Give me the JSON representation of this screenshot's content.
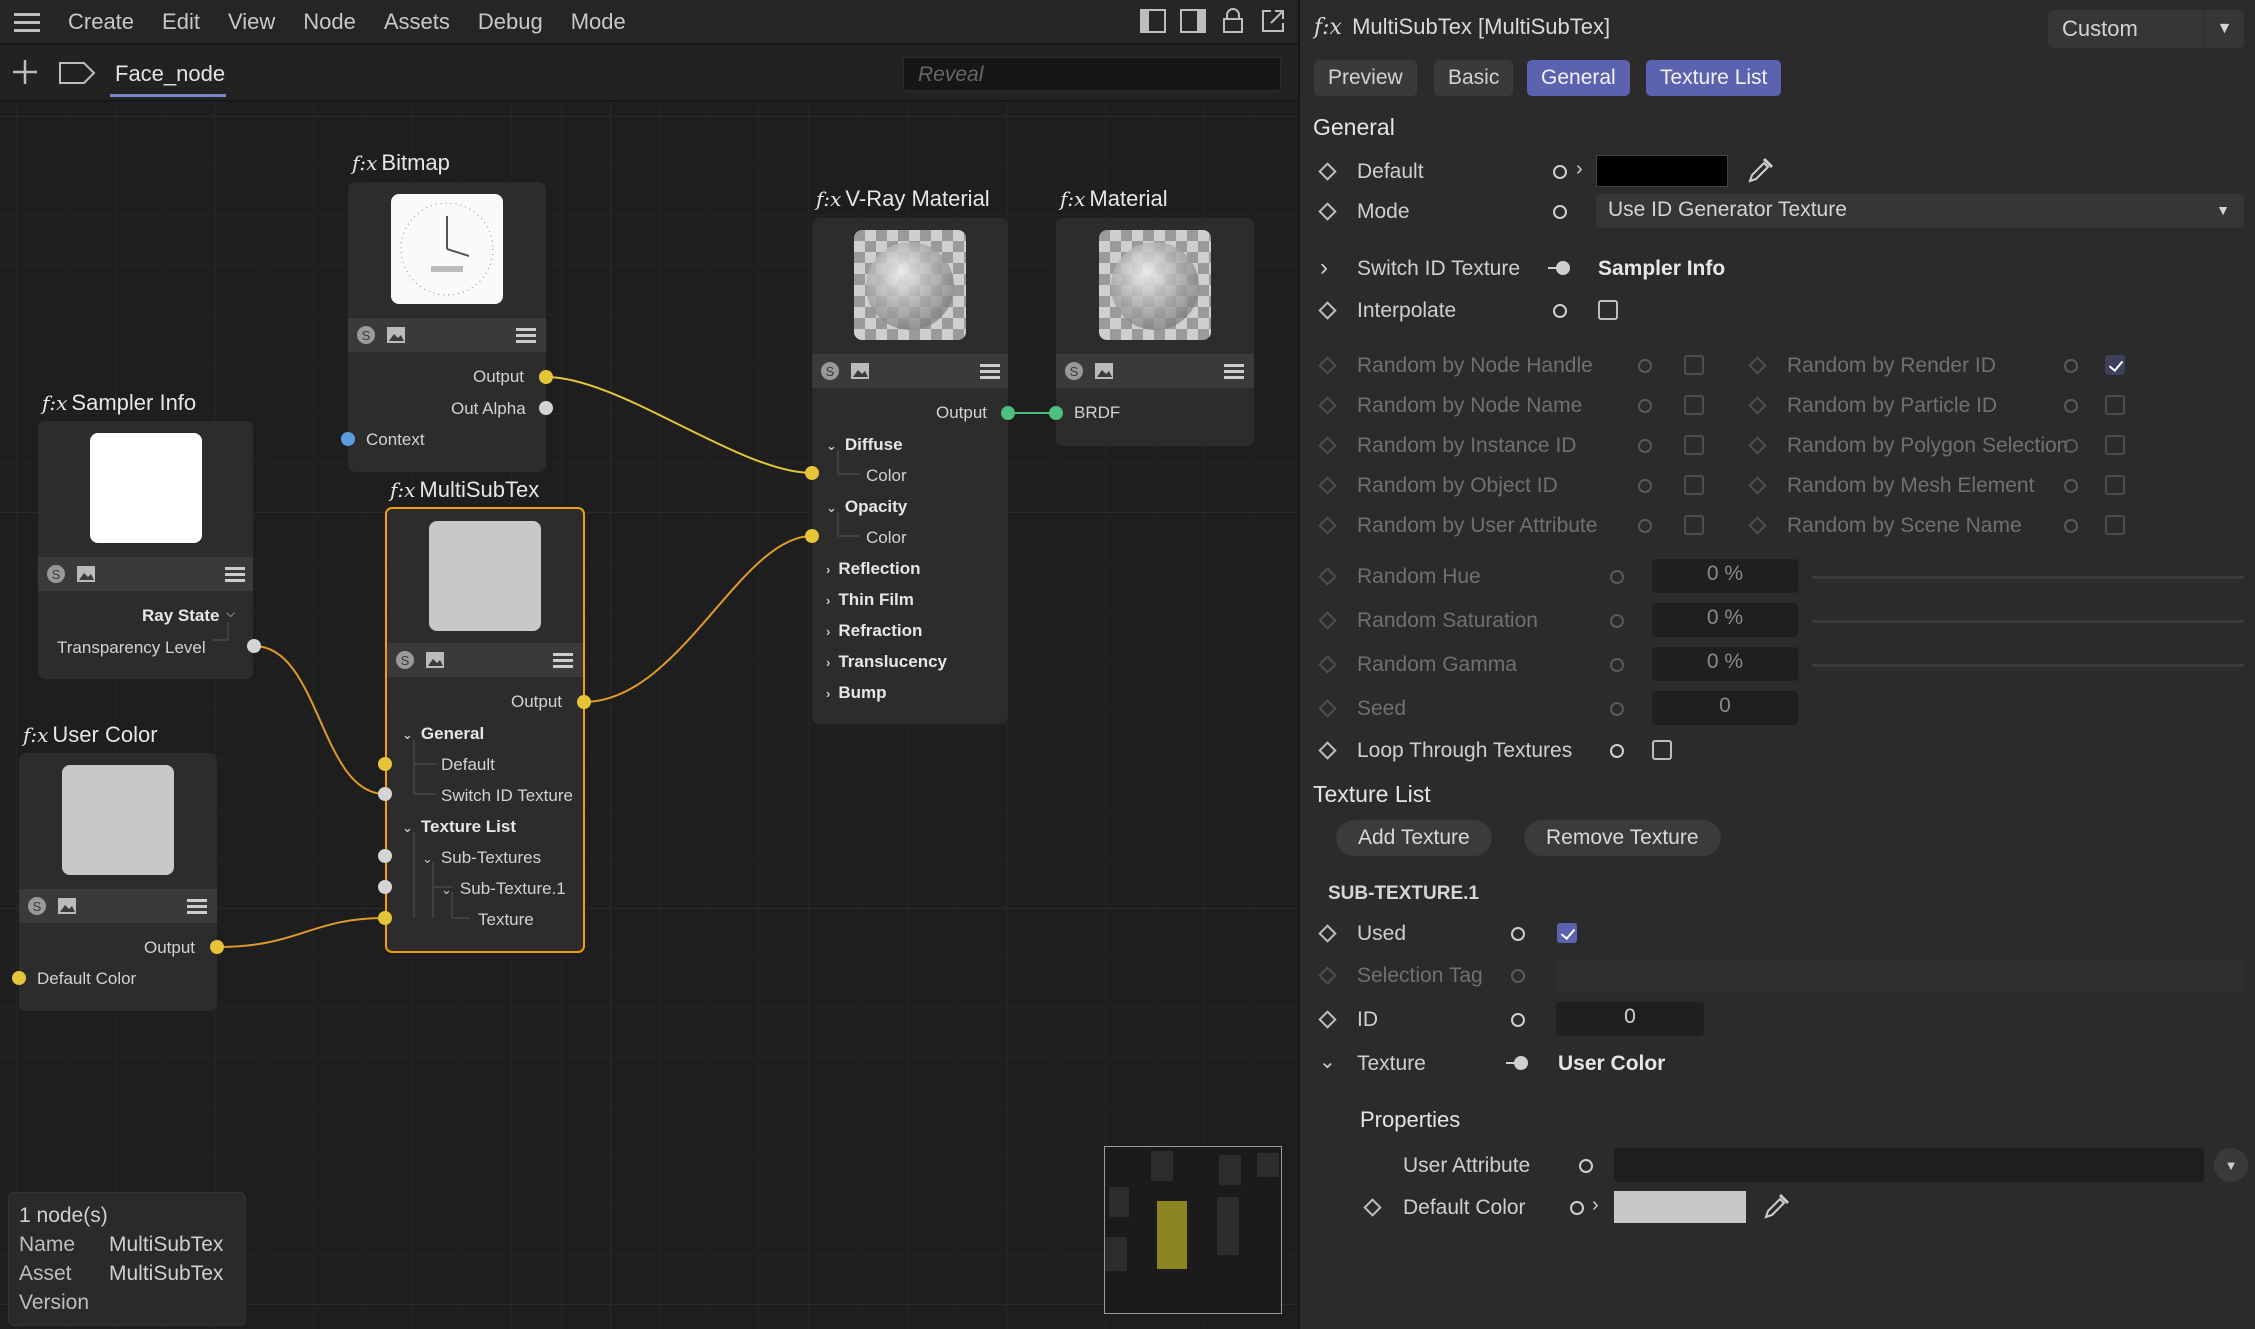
{
  "menu": {
    "items": [
      "Create",
      "Edit",
      "View",
      "Node",
      "Assets",
      "Debug",
      "Mode"
    ]
  },
  "tabs": {
    "active": "Face_node",
    "search_placeholder": "Reveal"
  },
  "nodes": {
    "bitmap": {
      "title": "Bitmap",
      "ports": {
        "output": "Output",
        "out_alpha": "Out Alpha",
        "context": "Context"
      }
    },
    "sampler": {
      "title": "Sampler Info",
      "ports": {
        "ray_state": "Ray State",
        "transparency": "Transparency Level"
      }
    },
    "usercolor": {
      "title": "User Color",
      "ports": {
        "output": "Output",
        "default_color": "Default Color"
      }
    },
    "multisub": {
      "title": "MultiSubTex",
      "ports": {
        "output": "Output",
        "general": "General",
        "default": "Default",
        "switch_id": "Switch ID Texture",
        "texture_list": "Texture List",
        "sub_textures": "Sub-Textures",
        "sub_texture_1": "Sub-Texture.1",
        "texture": "Texture"
      }
    },
    "vray": {
      "title": "V-Ray Material",
      "ports": {
        "output": "Output",
        "diffuse": "Diffuse",
        "diffuse_color": "Color",
        "opacity": "Opacity",
        "opacity_color": "Color",
        "reflection": "Reflection",
        "thin_film": "Thin Film",
        "refraction": "Refraction",
        "translucency": "Translucency",
        "bump": "Bump"
      }
    },
    "material": {
      "title": "Material",
      "ports": {
        "brdf": "BRDF"
      }
    }
  },
  "info": {
    "count": "1 node(s)",
    "name_label": "Name",
    "name": "MultiSubTex",
    "asset_label": "Asset",
    "asset": "MultiSubTex",
    "version_label": "Version"
  },
  "attr": {
    "title": "MultiSubTex [MultiSubTex]",
    "layout_select": "Custom",
    "tabs": [
      "Preview",
      "Basic",
      "General",
      "Texture List"
    ],
    "general": {
      "heading": "General",
      "default": "Default",
      "mode": "Mode",
      "mode_value": "Use ID Generator Texture",
      "switch_id": "Switch ID Texture",
      "switch_id_value": "Sampler Info",
      "interpolate": "Interpolate",
      "random_left": [
        "Random by Node Handle",
        "Random by Node Name",
        "Random by Instance ID",
        "Random by Object ID",
        "Random by User Attribute"
      ],
      "random_right": [
        "Random by Render ID",
        "Random by Particle ID",
        "Random by Polygon Selection",
        "Random by Mesh Element",
        "Random by Scene Name"
      ],
      "random_hue": "Random Hue",
      "random_hue_value": "0 %",
      "random_saturation": "Random Saturation",
      "random_saturation_value": "0 %",
      "random_gamma": "Random Gamma",
      "random_gamma_value": "0 %",
      "seed": "Seed",
      "seed_value": "0",
      "loop": "Loop Through Textures"
    },
    "texture_list": {
      "heading": "Texture List",
      "add": "Add Texture",
      "remove": "Remove Texture",
      "sub_heading": "SUB-TEXTURE.1",
      "used": "Used",
      "selection_tag": "Selection Tag",
      "id": "ID",
      "id_value": "0",
      "texture": "Texture",
      "texture_value": "User Color",
      "properties": "Properties",
      "user_attribute": "User Attribute",
      "default_color": "Default Color"
    }
  },
  "colors": {
    "accent": "#5b62b0",
    "selected_node": "#f0a000",
    "wire_yellow": "#e6c43a",
    "wire_orange": "#e09a28",
    "wire_green": "#4cc07c"
  }
}
